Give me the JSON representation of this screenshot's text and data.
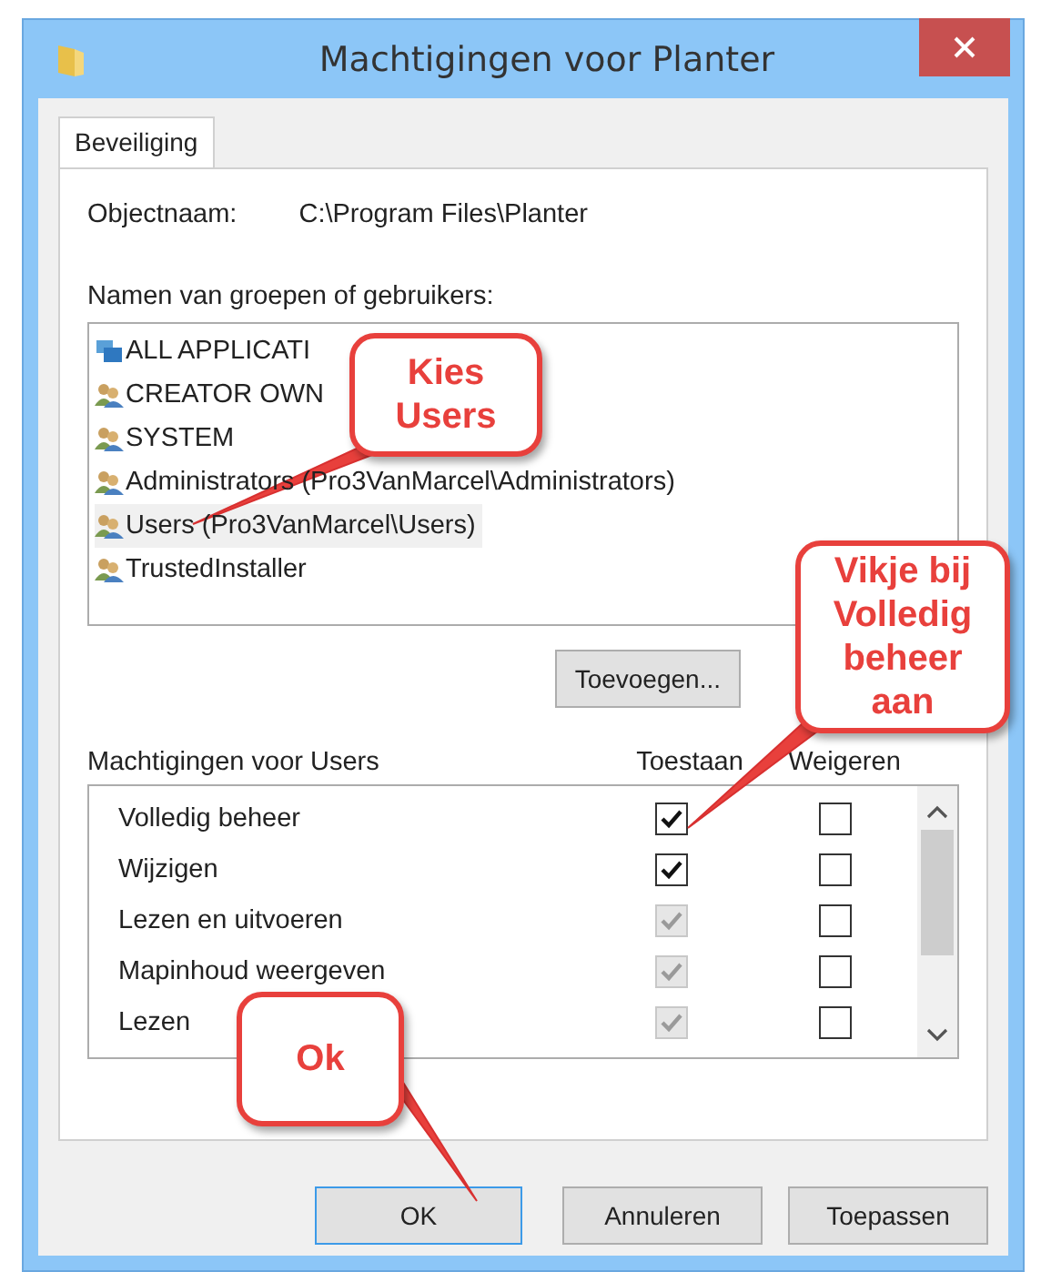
{
  "window": {
    "title": "Machtigingen voor Planter"
  },
  "tabs": [
    {
      "label": "Beveiliging",
      "selected": true
    }
  ],
  "object": {
    "label": "Objectnaam:",
    "value": "C:\\Program Files\\Planter"
  },
  "principals": {
    "label": "Namen van groepen of gebruikers:",
    "items": [
      {
        "name": "ALL APPLICATI",
        "kind": "package",
        "selected": false
      },
      {
        "name": "CREATOR OWN",
        "kind": "group",
        "selected": false
      },
      {
        "name": "SYSTEM",
        "kind": "group",
        "selected": false
      },
      {
        "name": "Administrators (Pro3VanMarcel\\Administrators)",
        "kind": "group",
        "selected": false
      },
      {
        "name": "Users (Pro3VanMarcel\\Users)",
        "kind": "group",
        "selected": true
      },
      {
        "name": "TrustedInstaller",
        "kind": "group",
        "selected": false
      }
    ]
  },
  "principal_buttons": [
    "Toevoegen..."
  ],
  "permissions": {
    "label": "Machtigingen voor Users",
    "allow_header": "Toestaan",
    "deny_header": "Weigeren",
    "rows": [
      {
        "name": "Volledig beheer",
        "allow": {
          "checked": true,
          "disabled": false
        },
        "deny": {
          "checked": false,
          "disabled": false
        }
      },
      {
        "name": "Wijzigen",
        "allow": {
          "checked": true,
          "disabled": false
        },
        "deny": {
          "checked": false,
          "disabled": false
        }
      },
      {
        "name": "Lezen en uitvoeren",
        "allow": {
          "checked": true,
          "disabled": true
        },
        "deny": {
          "checked": false,
          "disabled": false
        }
      },
      {
        "name": "Mapinhoud weergeven",
        "allow": {
          "checked": true,
          "disabled": true
        },
        "deny": {
          "checked": false,
          "disabled": false
        }
      },
      {
        "name": "Lezen",
        "allow": {
          "checked": true,
          "disabled": true
        },
        "deny": {
          "checked": false,
          "disabled": false
        }
      }
    ]
  },
  "buttons": [
    {
      "label": "OK",
      "default": true
    },
    {
      "label": "Annuleren",
      "default": false
    },
    {
      "label": "Toepassen",
      "default": false
    }
  ],
  "callouts": [
    {
      "text": "Kies Users"
    },
    {
      "text": "Vikje bij Volledig beheer aan"
    },
    {
      "text": "Ok"
    }
  ]
}
